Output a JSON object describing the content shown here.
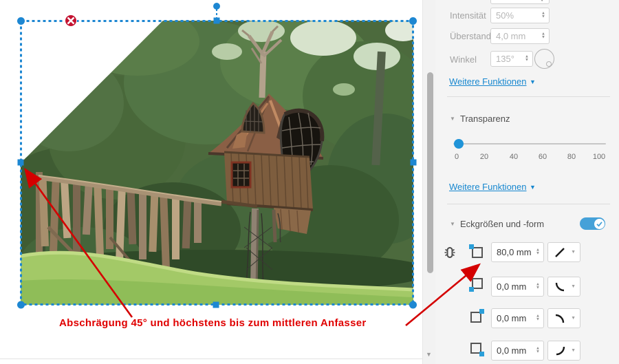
{
  "panel": {
    "fields": [
      {
        "id": "intensity",
        "label": "Intensität",
        "value": "50%",
        "disabled": true
      },
      {
        "id": "overhang",
        "label": "Überstand",
        "value": "4,0 mm",
        "disabled": true
      },
      {
        "id": "angle",
        "label": "Winkel",
        "value": "135°",
        "disabled": true
      }
    ],
    "more_functions_label": "Weitere Funktionen",
    "transparency": {
      "title": "Transparenz",
      "ticks": [
        "0",
        "20",
        "40",
        "60",
        "80",
        "100"
      ],
      "value_percent": 0
    },
    "corner_section": {
      "title": "Eckgrößen und -form",
      "toggle_on": true,
      "rows": [
        {
          "value": "80,0 mm",
          "handle_corner": "top-left",
          "shape": "bevel-diagonal"
        },
        {
          "value": "0,0 mm",
          "handle_corner": "bottom-left",
          "shape": "curve-bottom-left"
        },
        {
          "value": "0,0 mm",
          "handle_corner": "top-right",
          "shape": "curve-top-right"
        },
        {
          "value": "0,0 mm",
          "handle_corner": "bottom-right",
          "shape": "curve-bottom-right"
        }
      ]
    }
  },
  "annotation": {
    "text": "Abschrägung 45° und höchstens bis zum mittleren Anfasser"
  },
  "colors": {
    "selection_blue": "#1d87d2",
    "link_blue": "#1787cf",
    "toggle_blue": "#45a1d8",
    "annotation_red": "#e00000",
    "marker_red": "#c41230"
  }
}
